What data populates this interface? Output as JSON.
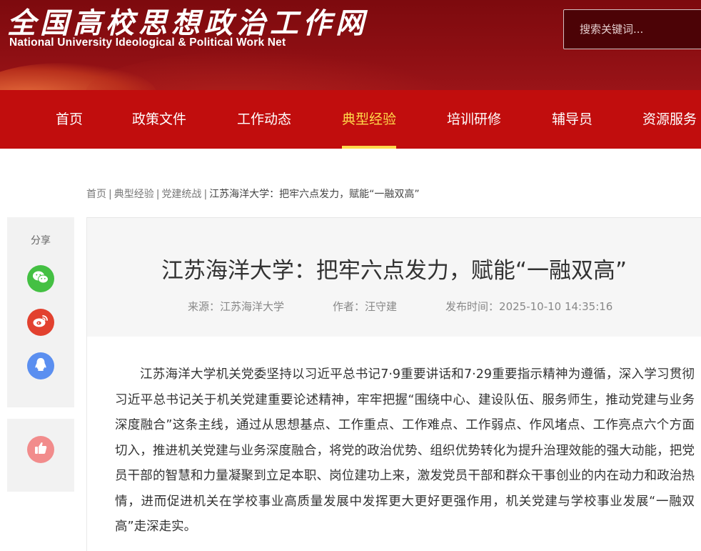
{
  "site": {
    "logo_cn": "全国高校思想政治工作网",
    "logo_en": "National University Ideological & Political Work Net"
  },
  "search": {
    "placeholder": "搜索关键词..."
  },
  "nav": {
    "items": [
      {
        "label": "首页"
      },
      {
        "label": "政策文件"
      },
      {
        "label": "工作动态"
      },
      {
        "label": "典型经验",
        "active": true
      },
      {
        "label": "培训研修"
      },
      {
        "label": "辅导员"
      },
      {
        "label": "资源服务"
      }
    ]
  },
  "breadcrumb": {
    "items": [
      "首页",
      "典型经验",
      "党建统战"
    ],
    "current": "江苏海洋大学：把牢六点发力，赋能“一融双高”"
  },
  "share": {
    "label": "分享",
    "buttons": [
      {
        "icon": "wechat-icon",
        "color": "#44c043"
      },
      {
        "icon": "weibo-icon",
        "color": "#e2412f"
      },
      {
        "icon": "qq-icon",
        "color": "#5b8ff0"
      }
    ],
    "like_icon": "thumbs-up-icon",
    "like_color": "#f28c8c"
  },
  "article": {
    "title": "江苏海洋大学：把牢六点发力，赋能“一融双高”",
    "source": "来源：江苏海洋大学",
    "author": "作者：汪守建",
    "published": "发布时间：2025-10-10 14:35:16",
    "body": "江苏海洋大学机关党委坚持以习近平总书记7·9重要讲话和7·29重要指示精神为遵循，深入学习贯彻习近平总书记关于机关党建重要论述精神，牢牢把握“围绕中心、建设队伍、服务师生，推动党建与业务深度融合”这条主线，通过从思想基点、工作重点、工作难点、工作弱点、作风堵点、工作亮点六个方面切入，推进机关党建与业务深度融合，将党的政治优势、组织优势转化为提升治理效能的强大动能，把党员干部的智慧和力量凝聚到立足本职、岗位建功上来，激发党员干部和群众干事创业的内在动力和政治热情，进而促进机关在学校事业高质量发展中发挥更大更好更强作用，机关党建与学校事业发展“一融双高”走深走实。"
  },
  "colors": {
    "header_bg": "#8e0f13",
    "nav_bg": "#c10d0d",
    "nav_active": "#ffd84a"
  }
}
